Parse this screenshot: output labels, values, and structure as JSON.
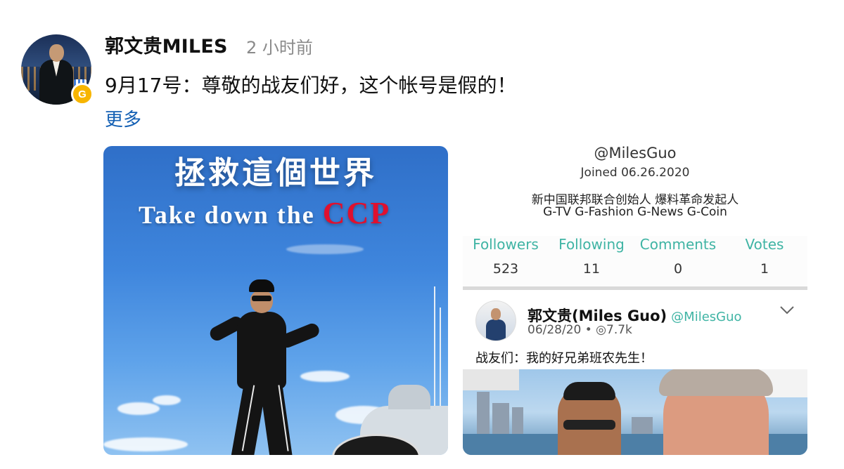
{
  "post": {
    "username": "郭文贵MILES",
    "time_ago": "2 小时前",
    "text": "9月17号：尊敬的战友们好，这个帐号是假的！",
    "more_label": "更多",
    "badge_letter": "G"
  },
  "image1": {
    "headline_cn": "拯救這個世界",
    "headline_en": "Take down the",
    "headline_en_highlight": "CCP"
  },
  "image2": {
    "handle": "@MilesGuo",
    "joined": "Joined 06.26.2020",
    "bio_line1": "新中国联邦联合创始人 爆料革命发起人",
    "bio_line2": "G-TV G-Fashion G-News G-Coin",
    "stats": [
      {
        "label": "Followers",
        "value": "523"
      },
      {
        "label": "Following",
        "value": "11"
      },
      {
        "label": "Comments",
        "value": "0"
      },
      {
        "label": "Votes",
        "value": "1"
      }
    ],
    "post_author": "郭文贵(Miles Guo)",
    "post_handle": "@MilesGuo",
    "post_meta": "06/28/20 • ◎7.7k",
    "post_text": "战友们：我的好兄弟班农先生！"
  },
  "colors": {
    "link": "#1460b4",
    "accent_teal": "#3fb4a4",
    "ccp_red": "#e0102e",
    "badge_gold": "#f7b500"
  },
  "icons": {
    "verified_badge": "medal-g-icon",
    "dropdown": "chevron-down-icon",
    "views": "eye-icon"
  }
}
